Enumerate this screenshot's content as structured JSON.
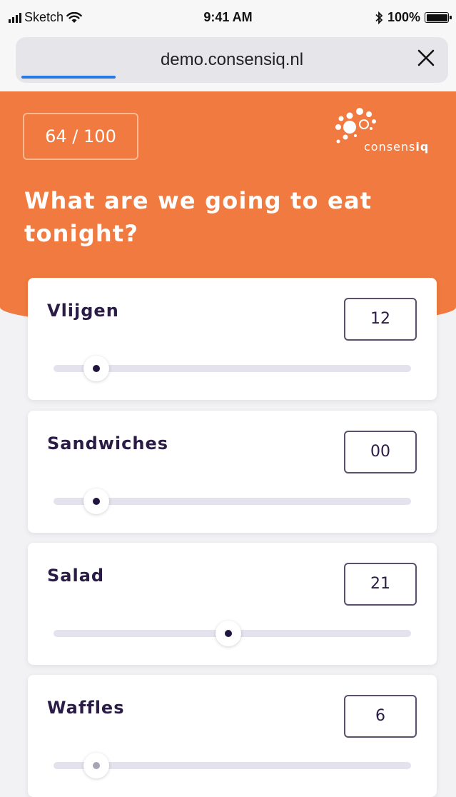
{
  "status_bar": {
    "carrier": "Sketch",
    "time": "9:41 AM",
    "battery": "100%",
    "icons": [
      "signal-icon",
      "wifi-icon",
      "bluetooth-icon",
      "battery-icon"
    ]
  },
  "browser": {
    "url": "demo.consensiq.nl",
    "close_icon": "close-icon"
  },
  "header": {
    "counter": "64 / 100",
    "logo_prefix": "consens",
    "logo_suffix": "iq",
    "question": "What are we going to eat tonight?",
    "background_color": "#f07a40"
  },
  "options": [
    {
      "label": "Vlijgen",
      "value": "12",
      "slider_level": 0.12
    },
    {
      "label": "Sandwiches",
      "value": "00",
      "slider_level": 0.12
    },
    {
      "label": "Salad",
      "value": "21",
      "slider_level": 0.49
    },
    {
      "label": "Waffles",
      "value": "6",
      "slider_level": 0.12
    }
  ],
  "colors": {
    "accent": "#f07a40",
    "text_dark": "#2a1c45",
    "track": "#e4e2ec"
  }
}
